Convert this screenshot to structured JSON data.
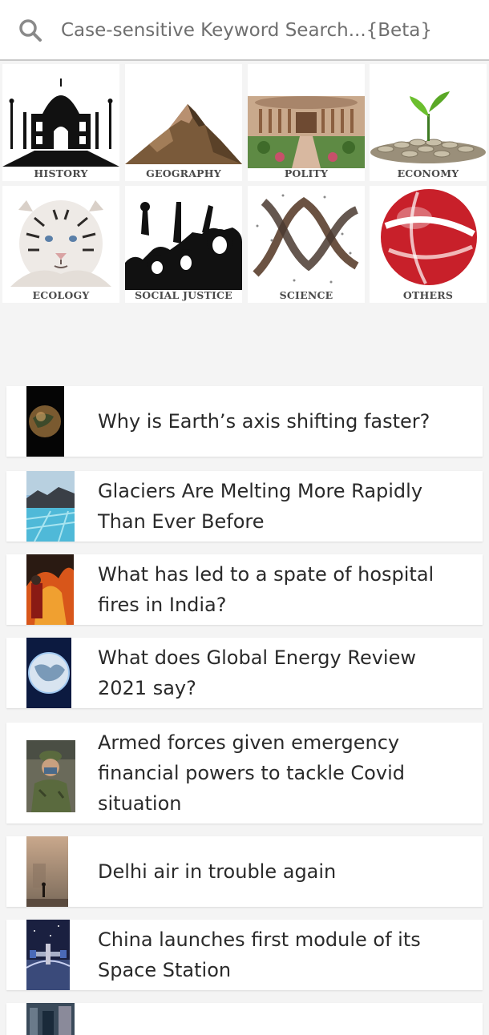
{
  "search": {
    "placeholder": "Case-sensitive Keyword Search...{Beta}",
    "icon": "search-icon"
  },
  "categories": [
    {
      "label": "HISTORY",
      "icon": "taj-mahal-icon"
    },
    {
      "label": "GEOGRAPHY",
      "icon": "mountain-icon"
    },
    {
      "label": "POLITY",
      "icon": "parliament-icon"
    },
    {
      "label": "ECONOMY",
      "icon": "coins-plant-icon"
    },
    {
      "label": "ECOLOGY",
      "icon": "tiger-icon"
    },
    {
      "label": "SOCIAL JUSTICE",
      "icon": "protest-icon"
    },
    {
      "label": "SCIENCE",
      "icon": "dna-icon"
    },
    {
      "label": "OTHERS",
      "icon": "globe-icon"
    }
  ],
  "articles": [
    {
      "title": "Why is Earth’s axis shifting faster?"
    },
    {
      "title": "Glaciers Are Melting More Rapidly Than Ever Before"
    },
    {
      "title": "What has led to a spate of hospital fires in India?"
    },
    {
      "title": "What does Global Energy Review 2021 say?"
    },
    {
      "title": "Armed forces given emergency financial powers to tackle Covid situation"
    },
    {
      "title": "Delhi air in trouble again"
    },
    {
      "title": "China launches first module of its Space Station"
    }
  ]
}
